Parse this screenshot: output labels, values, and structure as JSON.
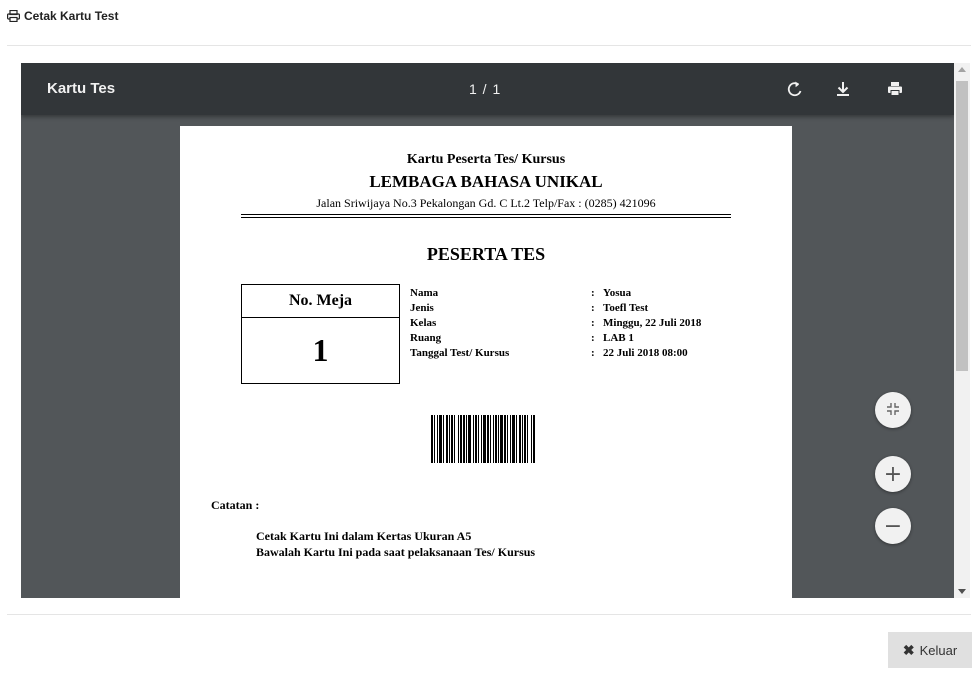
{
  "modal": {
    "title": "Cetak Kartu Test",
    "title_icon": "print-icon"
  },
  "viewer": {
    "title": "Kartu Tes",
    "page_indicator": "1 / 1",
    "icons": [
      "rotate-icon",
      "download-icon",
      "print-icon"
    ]
  },
  "document": {
    "heading1": "Kartu Peserta Tes/ Kursus",
    "heading2": "LEMBAGA BAHASA UNIKAL",
    "address": "Jalan Sriwijaya No.3 Pekalongan Gd. C Lt.2 Telp/Fax : (0285) 421096",
    "section_title": "PESERTA TES",
    "meja_label": "No. Meja",
    "meja_number": "1",
    "info": [
      {
        "key": "Nama",
        "colon": ":",
        "value": "Yosua"
      },
      {
        "key": "Jenis",
        "colon": ":",
        "value": "Toefl Test"
      },
      {
        "key": "Kelas",
        "colon": ":",
        "value": "Minggu, 22 Juli 2018"
      },
      {
        "key": "Ruang",
        "colon": ":",
        "value": "LAB 1"
      },
      {
        "key": "Tanggal Test/ Kursus",
        "colon": ":",
        "value": "22 Juli 2018 08:00"
      }
    ],
    "catatan_label": "Catatan :",
    "catatan_lines": [
      "Cetak Kartu Ini dalam Kertas Ukuran A5",
      "Bawalah Kartu Ini pada saat pelaksanaan Tes/ Kursus"
    ]
  },
  "zoom_controls": {
    "fit": "fit-page-icon",
    "plus": "+",
    "minus": "−"
  },
  "footer": {
    "close_label": "Keluar",
    "close_icon": "close-icon"
  }
}
